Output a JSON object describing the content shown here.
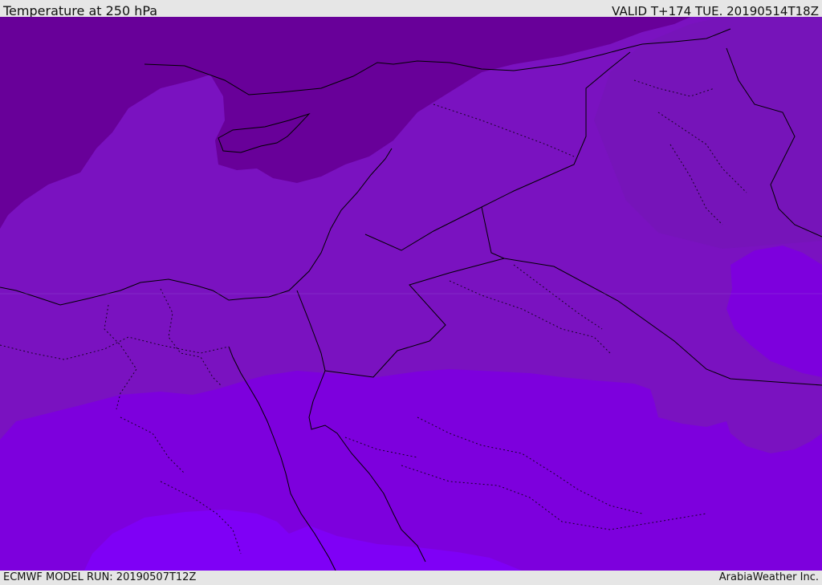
{
  "header": {
    "title": "Temperature at 250 hPa",
    "valid_time": "VALID T+174 TUE. 20190514T18Z"
  },
  "footer": {
    "model_run": "ECMWF MODEL RUN: 20190507T12Z",
    "credit": "ArabiaWeather Inc."
  },
  "palette": {
    "band_coldest": "#680099",
    "band_cold": "#7710b5",
    "band_mid": "#7a12c0",
    "band_warm": "#7d00dd",
    "band_warmest": "#7f00f6",
    "border_line": "#000000"
  }
}
